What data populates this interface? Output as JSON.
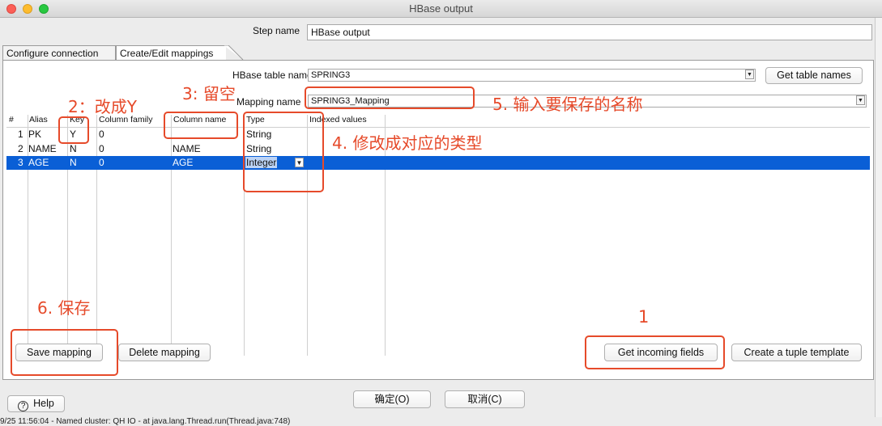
{
  "window": {
    "title": "HBase output"
  },
  "step": {
    "label": "Step name",
    "value": "HBase output"
  },
  "tabs": [
    {
      "label": "Configure connection"
    },
    {
      "label": "Create/Edit mappings"
    }
  ],
  "hbase_table": {
    "label": "HBase table name",
    "value": "SPRING3",
    "button": "Get table names"
  },
  "mapping": {
    "label": "Mapping name",
    "value": "SPRING3_Mapping"
  },
  "table": {
    "headers": [
      "#",
      "Alias",
      "Key",
      "Column family",
      "Column name",
      "Type",
      "Indexed values"
    ],
    "rows": [
      {
        "num": "1",
        "alias": "PK",
        "key": "Y",
        "family": "0",
        "column": "",
        "type": "String",
        "indexed": ""
      },
      {
        "num": "2",
        "alias": "NAME",
        "key": "N",
        "family": "0",
        "column": "NAME",
        "type": "String",
        "indexed": ""
      },
      {
        "num": "3",
        "alias": "AGE",
        "key": "N",
        "family": "0",
        "column": "AGE",
        "type": "Integer",
        "indexed": ""
      }
    ],
    "selected_row": 3
  },
  "buttons": {
    "save_mapping": "Save mapping",
    "delete_mapping": "Delete mapping",
    "get_incoming": "Get incoming fields",
    "create_tuple": "Create a tuple template",
    "help": "Help",
    "ok": "确定(O)",
    "cancel": "取消(C)"
  },
  "annotations": {
    "a1": "1",
    "a2": "2：改成Y",
    "a3": "3: 留空",
    "a4": "4. 修改成对应的类型",
    "a5": "5. 输入要保存的名称",
    "a6": "6. 保存"
  },
  "log": {
    "text": "9/25 11:56:04 - Named cluster: QH IO -  at java.lang.Thread.run(Thread.java:748)"
  },
  "colors": {
    "selection": "#0a5fd6",
    "annotation": "#e64a2a"
  }
}
